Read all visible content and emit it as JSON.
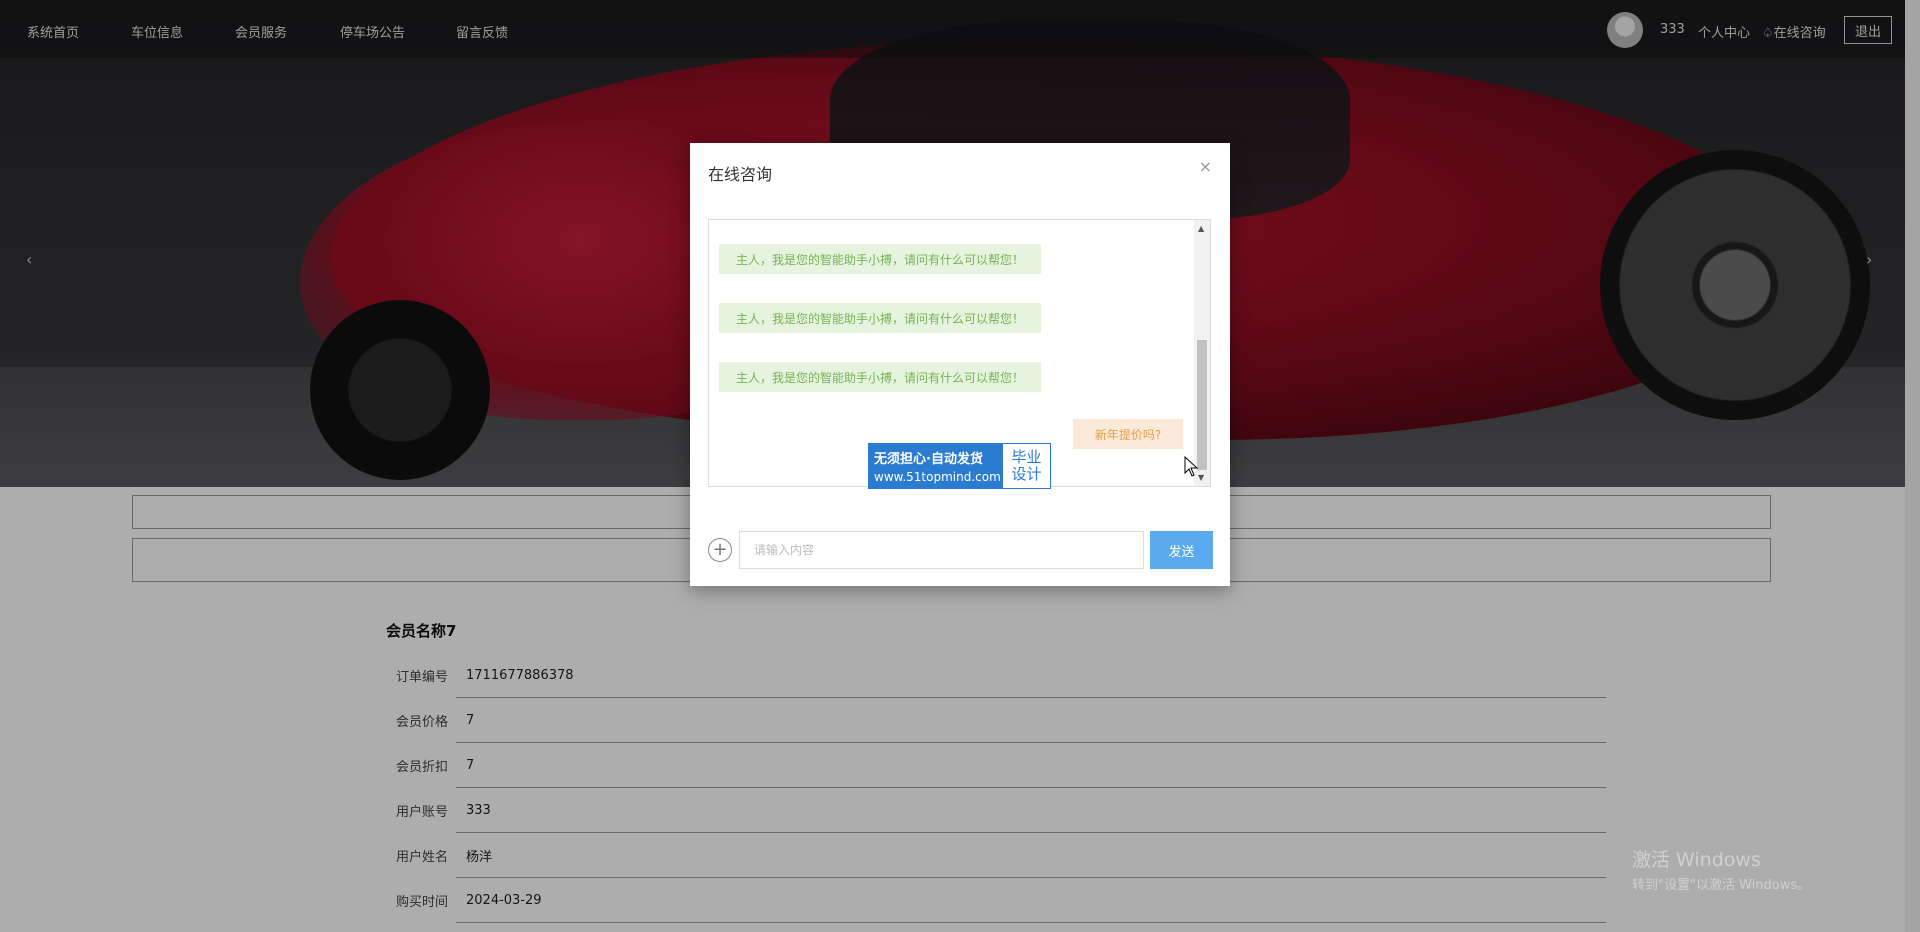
{
  "nav": {
    "items": [
      "系统首页",
      "车位信息",
      "会员服务",
      "停车场公告",
      "留言反馈"
    ],
    "user_name": "333",
    "user_center": "个人中心",
    "consult": "在线咨询",
    "logout": "退出"
  },
  "carousel": {
    "prev": "‹",
    "next": "›"
  },
  "detail": {
    "title": "会员名称7",
    "rows": [
      {
        "label": "订单编号",
        "value": "1711677886378"
      },
      {
        "label": "会员价格",
        "value": "7"
      },
      {
        "label": "会员折扣",
        "value": "7"
      },
      {
        "label": "用户账号",
        "value": "333"
      },
      {
        "label": "用户姓名",
        "value": "杨洋"
      },
      {
        "label": "购买时间",
        "value": "2024-03-29"
      }
    ]
  },
  "modal": {
    "title": "在线咨询",
    "close": "×",
    "messages": [
      {
        "from": "bot",
        "text": "主人，我是您的智能助手小搏，请问有什么可以帮您！"
      },
      {
        "from": "bot",
        "text": "主人，我是您的智能助手小搏，请问有什么可以帮您！"
      },
      {
        "from": "bot",
        "text": "主人，我是您的智能助手小搏，请问有什么可以帮您！"
      },
      {
        "from": "user",
        "text": "新年提价吗?"
      }
    ],
    "input_placeholder": "请输入内容",
    "send": "发送"
  },
  "promo": {
    "line1": "无须担心·自动发货",
    "line2": "www.51topmind.com",
    "badge1": "毕业",
    "badge2": "设计"
  },
  "os_watermark": {
    "line1": "激活 Windows",
    "line2": "转到\"设置\"以激活 Windows。"
  }
}
